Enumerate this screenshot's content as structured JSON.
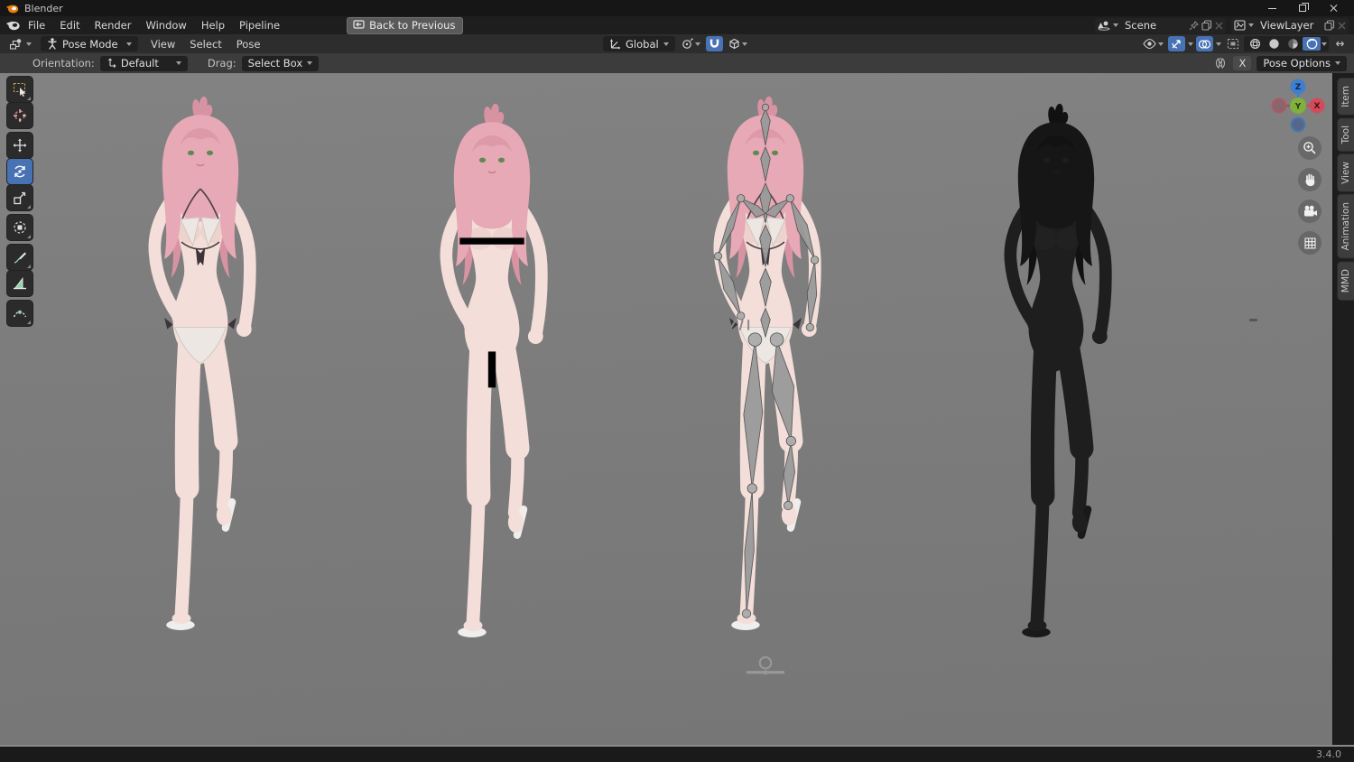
{
  "window": {
    "title": "Blender"
  },
  "menubar": {
    "items": [
      "File",
      "Edit",
      "Render",
      "Window",
      "Help",
      "Pipeline"
    ],
    "back_button": "Back to Previous",
    "scene": "Scene",
    "view_layer": "ViewLayer"
  },
  "viewport_header": {
    "mode": "Pose Mode",
    "menu_view": "View",
    "menu_select": "Select",
    "menu_pose": "Pose",
    "orientation": "Global"
  },
  "tool_settings": {
    "orientation_label": "Orientation:",
    "orientation_value": "Default",
    "drag_label": "Drag:",
    "drag_value": "Select Box",
    "mirror_x_label": "X",
    "pose_options_label": "Pose Options"
  },
  "toolbar_tools": [
    {
      "name": "select-box",
      "active": false
    },
    {
      "name": "cursor",
      "active": false
    },
    {
      "name": "move",
      "active": false
    },
    {
      "name": "rotate",
      "active": true
    },
    {
      "name": "scale",
      "active": false
    },
    {
      "name": "transform",
      "active": false
    },
    {
      "name": "annotate",
      "active": false
    },
    {
      "name": "measure",
      "active": false
    },
    {
      "name": "pose-breakdowner",
      "active": false
    }
  ],
  "gizmo_axes": {
    "x": "X",
    "y": "Y",
    "z": "Z"
  },
  "sidebar_tabs": [
    "Item",
    "Tool",
    "View",
    "Animation",
    "MMD"
  ],
  "status": {
    "version": "3.4.0"
  },
  "scene_content": {
    "figures": [
      "textured-model",
      "textured-model-censored",
      "model-with-armature",
      "wireframe-model"
    ],
    "character": "pink-haired girl in striped bikini, running pose"
  },
  "colors": {
    "accent_blue": "#4772b3",
    "viewport_bg": "#7d7d7d",
    "hair_pink": "#e7a9b5",
    "skin": "#f3ded9",
    "censor_black": "#000000",
    "wireframe_dark": "#1d1d1d",
    "axis_x_red": "#d24b5a",
    "axis_y_green": "#7fb13c",
    "axis_z_blue": "#3f7fd1",
    "logo_orange": "#e87d0d"
  }
}
